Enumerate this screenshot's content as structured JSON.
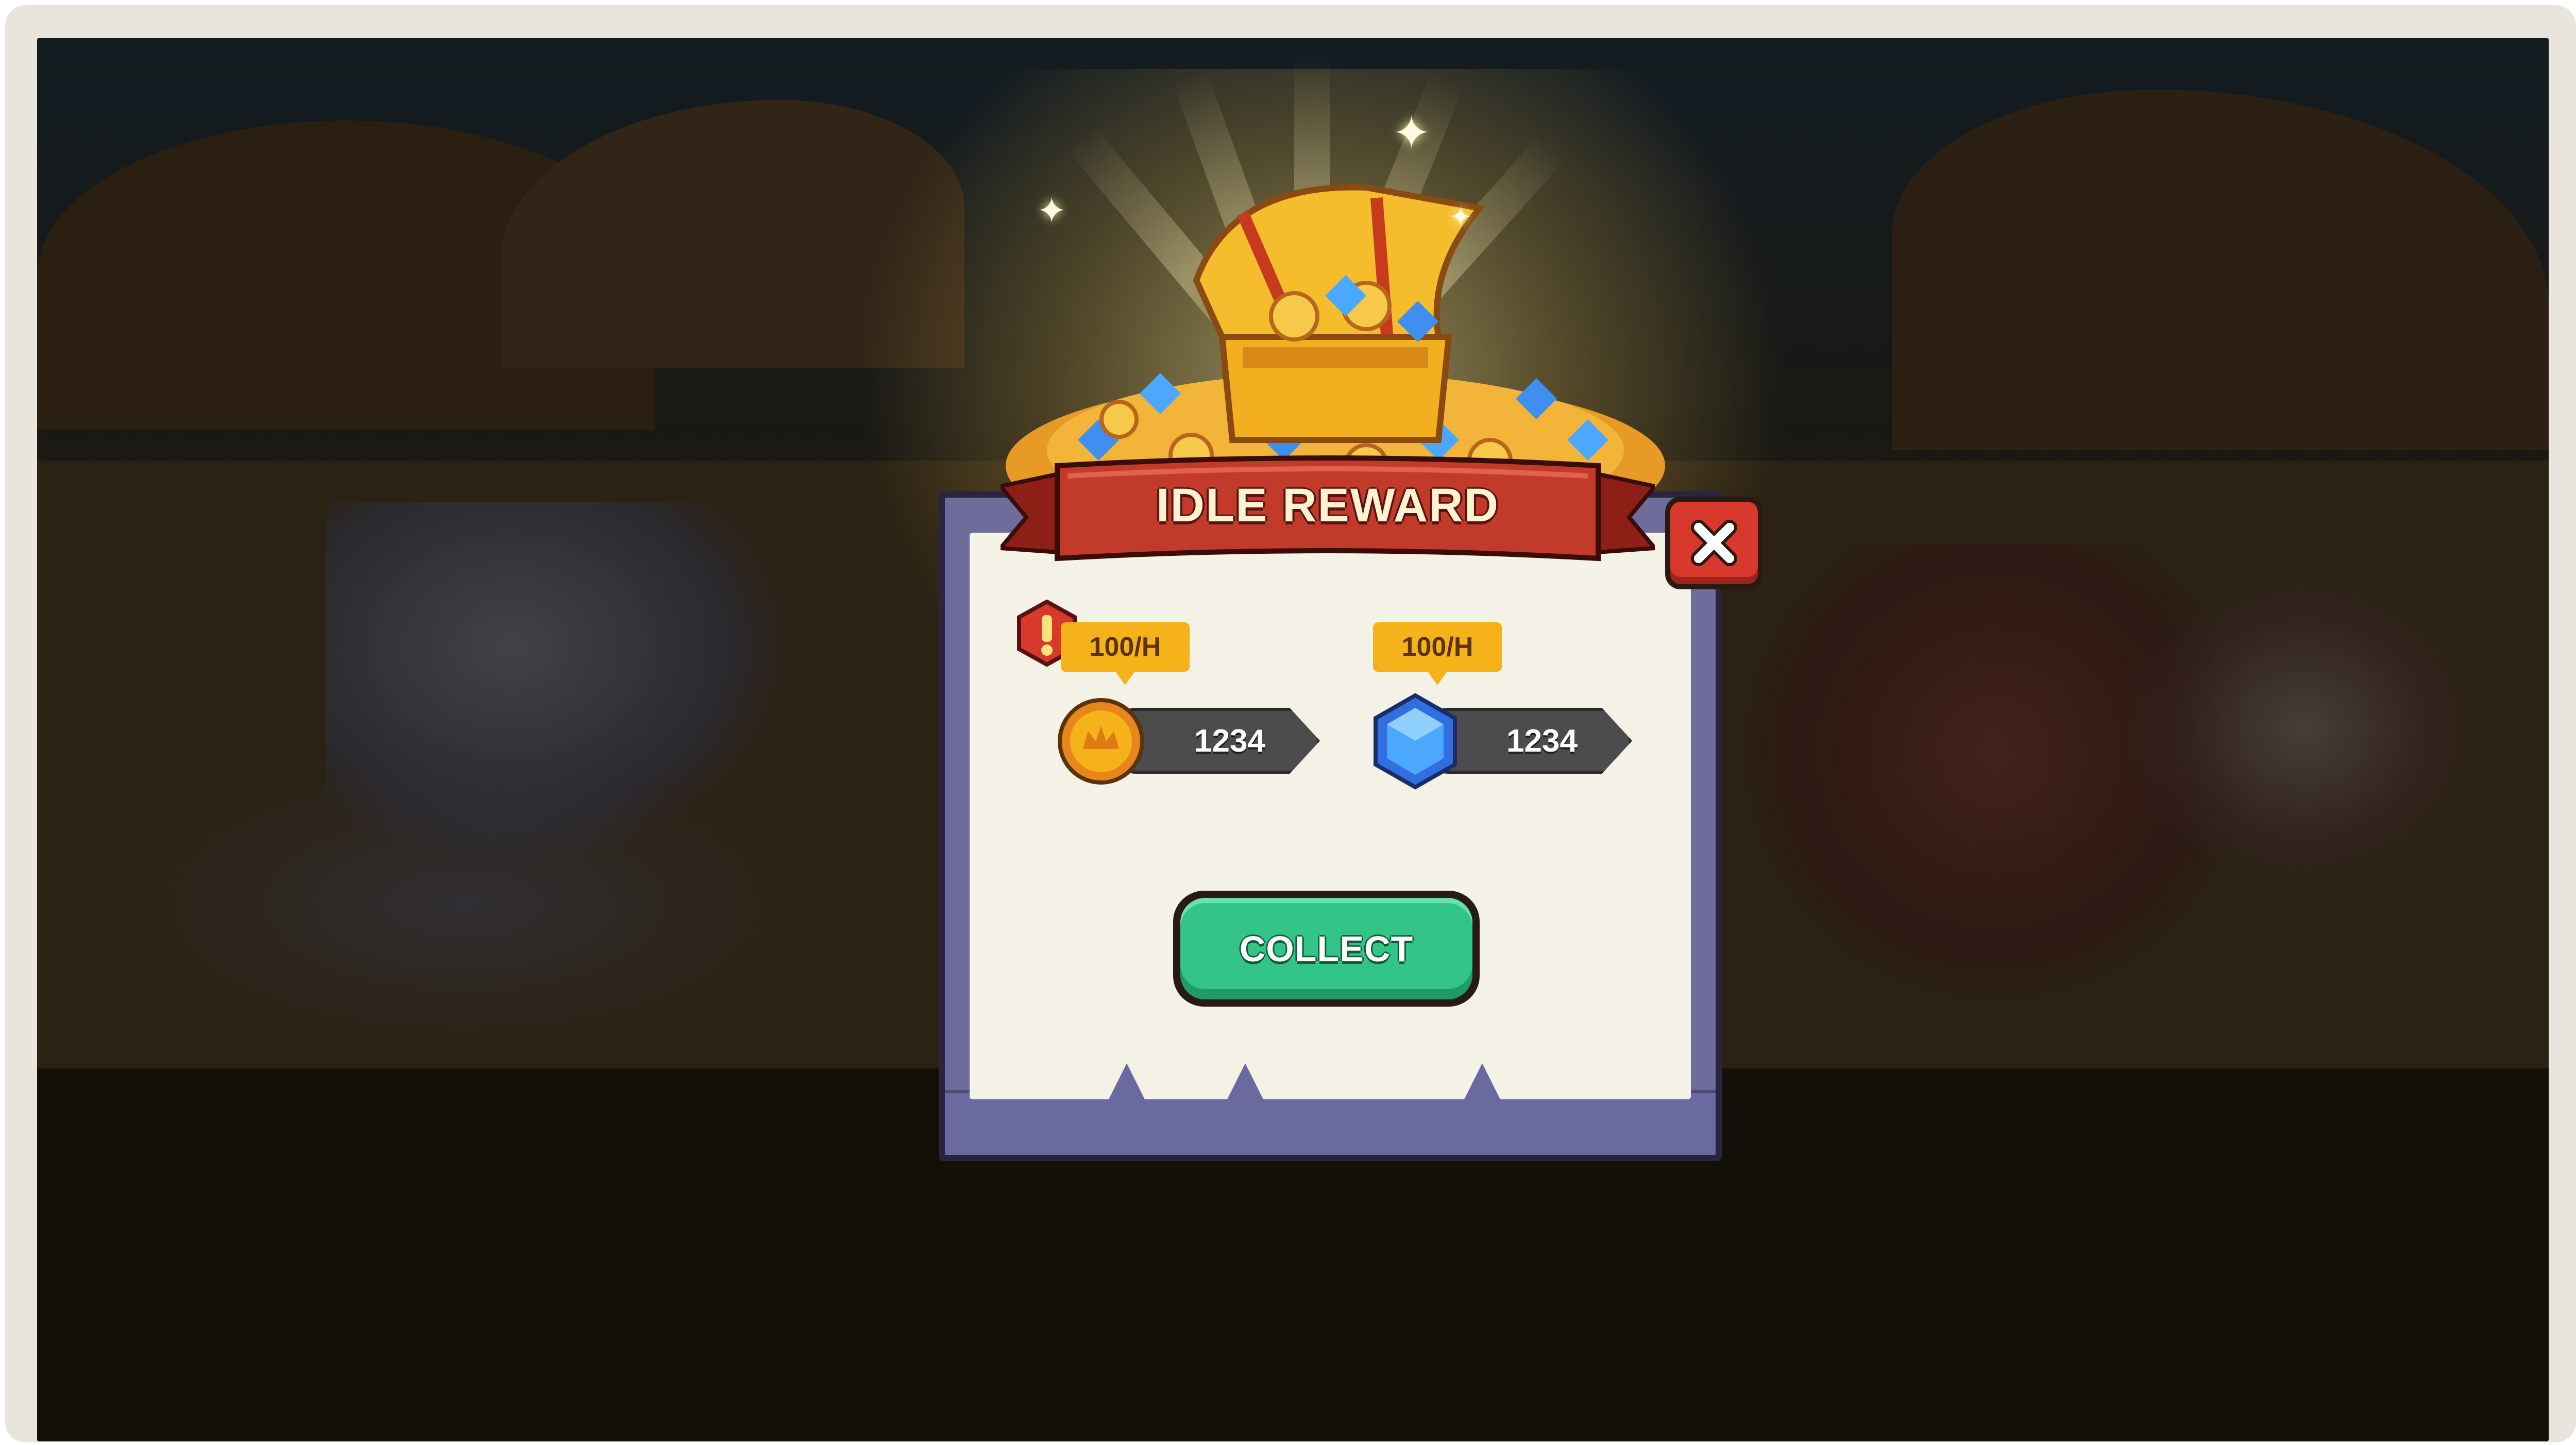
{
  "dialog": {
    "title": "IDLE REWARD",
    "close_icon": "close-x-icon",
    "warning_icon": "exclamation-hexagon-icon"
  },
  "rewards": [
    {
      "icon": "gold-coin-icon",
      "rate": "100/H",
      "amount": "1234"
    },
    {
      "icon": "blue-gem-icon",
      "rate": "100/H",
      "amount": "1234"
    }
  ],
  "collect": {
    "label": "COLLECT"
  },
  "colors": {
    "banner": "#c23a2a",
    "collect": "#33c487",
    "close": "#d8392c",
    "rate_badge": "#f6b21a",
    "panel_frame": "#6d6c9a",
    "panel_paper": "#f4f2e7"
  }
}
